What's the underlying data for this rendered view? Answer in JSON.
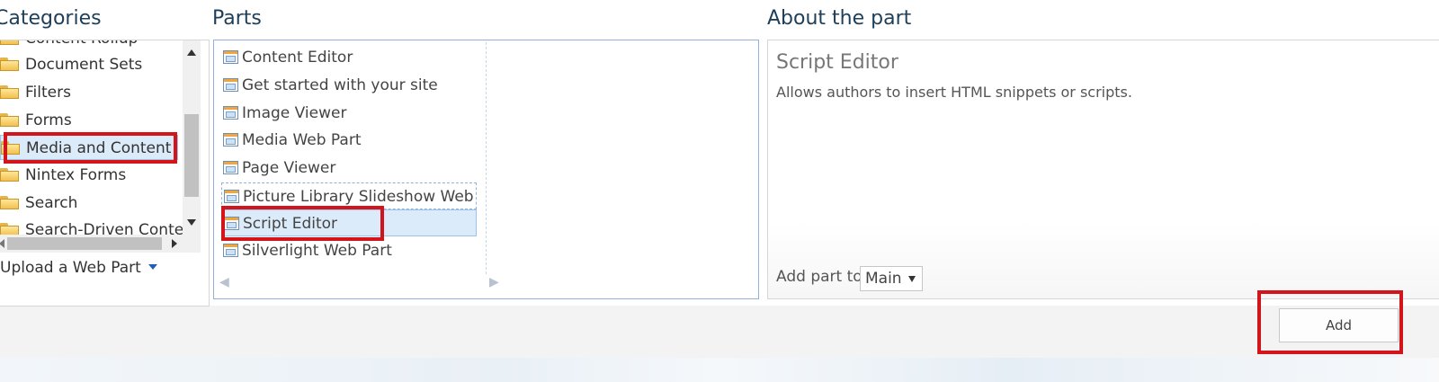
{
  "headers": {
    "categories": "Categories",
    "parts": "Parts",
    "about": "About the part"
  },
  "categories": {
    "items": [
      {
        "label": "Content Rollup",
        "icon": "folder-icon",
        "selected": false
      },
      {
        "label": "Document Sets",
        "icon": "folder-icon",
        "selected": false
      },
      {
        "label": "Filters",
        "icon": "folder-icon",
        "selected": false
      },
      {
        "label": "Forms",
        "icon": "folder-icon",
        "selected": false
      },
      {
        "label": "Media and Content",
        "icon": "folder-icon",
        "selected": true
      },
      {
        "label": "Nintex Forms",
        "icon": "folder-icon",
        "selected": false
      },
      {
        "label": "Search",
        "icon": "folder-icon",
        "selected": false
      },
      {
        "label": "Search-Driven Content",
        "icon": "folder-icon",
        "selected": false
      }
    ],
    "upload_label": "Upload a Web Part"
  },
  "parts": {
    "items": [
      {
        "label": "Content Editor",
        "icon": "web-part-icon",
        "state": "normal"
      },
      {
        "label": "Get started with your site",
        "icon": "web-part-icon",
        "state": "normal"
      },
      {
        "label": "Image Viewer",
        "icon": "web-part-icon",
        "state": "normal"
      },
      {
        "label": "Media Web Part",
        "icon": "web-part-icon",
        "state": "normal"
      },
      {
        "label": "Page Viewer",
        "icon": "web-part-icon",
        "state": "normal"
      },
      {
        "label": "Picture Library Slideshow Web Part",
        "icon": "web-part-icon",
        "state": "focused"
      },
      {
        "label": "Script Editor",
        "icon": "web-part-icon",
        "state": "selected"
      },
      {
        "label": "Silverlight Web Part",
        "icon": "web-part-icon",
        "state": "normal"
      }
    ]
  },
  "about": {
    "title": "Script Editor",
    "description": "Allows authors to insert HTML snippets or scripts.",
    "add_to_label": "Add part to:",
    "zone_value": "Main"
  },
  "actions": {
    "add_label": "Add"
  },
  "colors": {
    "highlight": "#d4141b",
    "selection_bg": "#dcebfa",
    "header_text": "#1e3f5a"
  }
}
